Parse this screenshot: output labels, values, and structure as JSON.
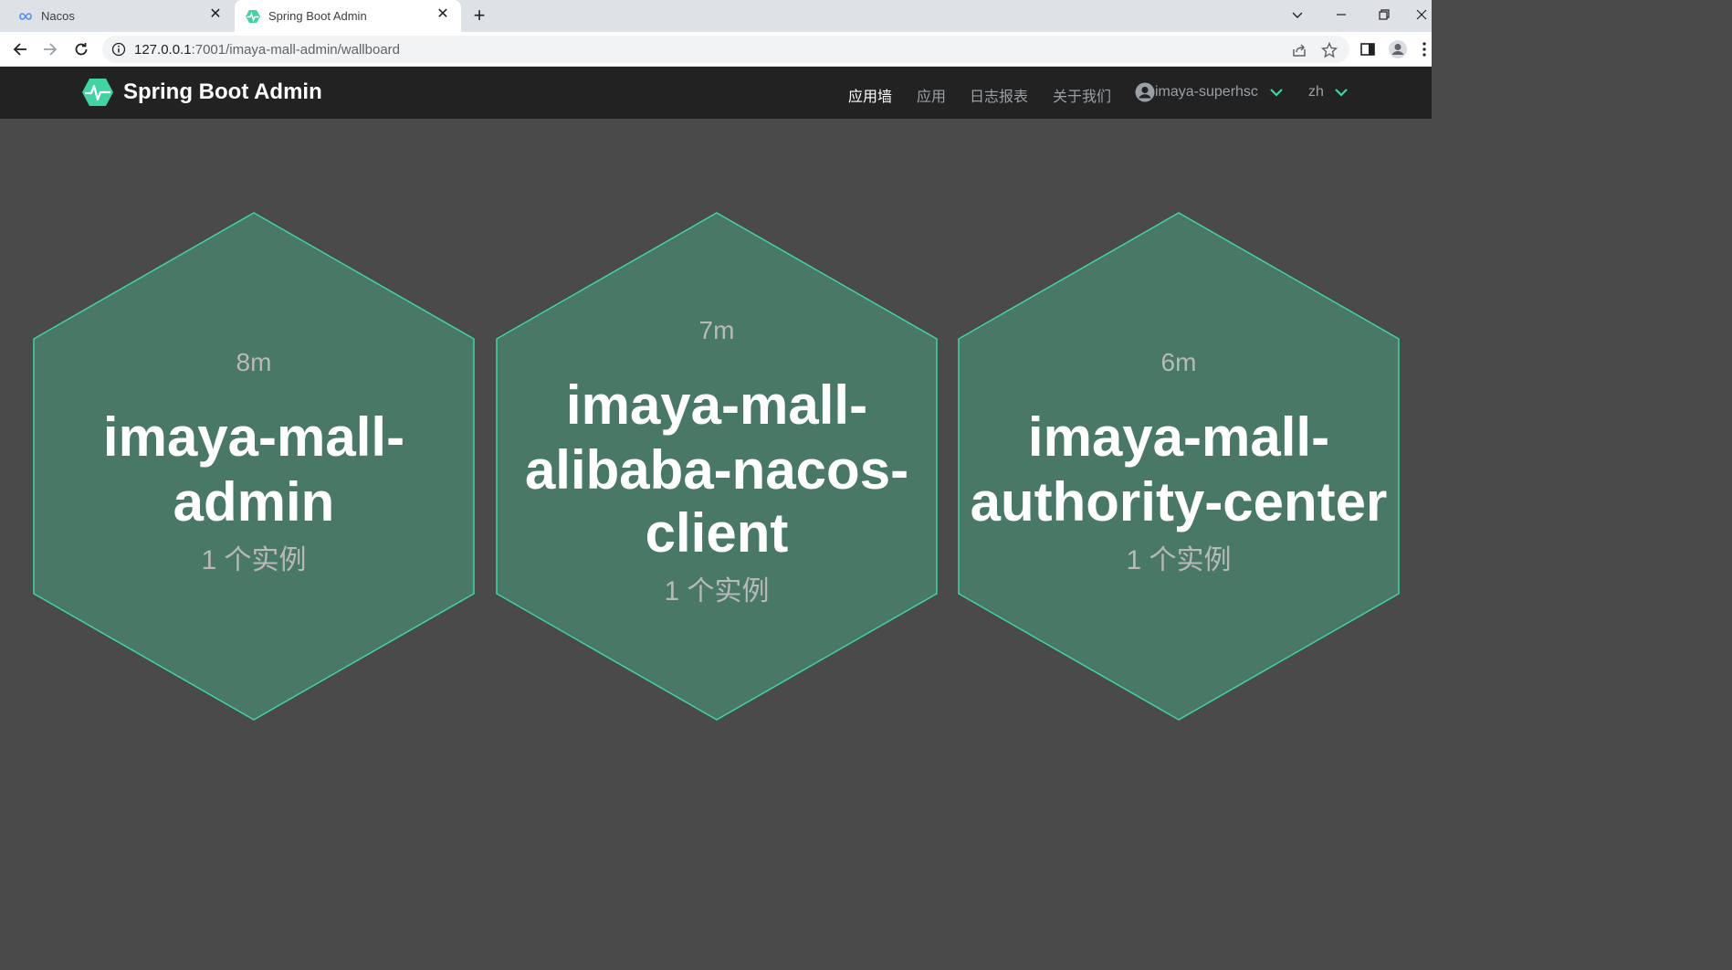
{
  "browser": {
    "tabs": [
      {
        "title": "Nacos",
        "active": false
      },
      {
        "title": "Spring Boot Admin",
        "active": true
      }
    ],
    "url_host": "127.0.0.1",
    "url_path": ":7001/imaya-mall-admin/wallboard"
  },
  "navbar": {
    "brand": "Spring Boot Admin",
    "links": [
      "应用墙",
      "应用",
      "日志报表",
      "关于我们"
    ],
    "active_link": "应用墙",
    "user": "imaya-superhsc",
    "language": "zh"
  },
  "wallboard": {
    "applications": [
      {
        "uptime": "8m",
        "name_lines": [
          "imaya-mall-",
          "admin"
        ],
        "instances": "1 个实例"
      },
      {
        "uptime": "7m",
        "name_lines": [
          "imaya-mall-",
          "alibaba-nacos-",
          "client"
        ],
        "instances": "1 个实例"
      },
      {
        "uptime": "6m",
        "name_lines": [
          "imaya-mall-",
          "authority-center"
        ],
        "instances": "1 个实例"
      }
    ]
  },
  "colors": {
    "hex_fill": "#497867",
    "hex_stroke": "#42d3a5",
    "background": "#4a4a4a",
    "navbar_bg": "#222222",
    "brand_green": "#42d3a5"
  }
}
